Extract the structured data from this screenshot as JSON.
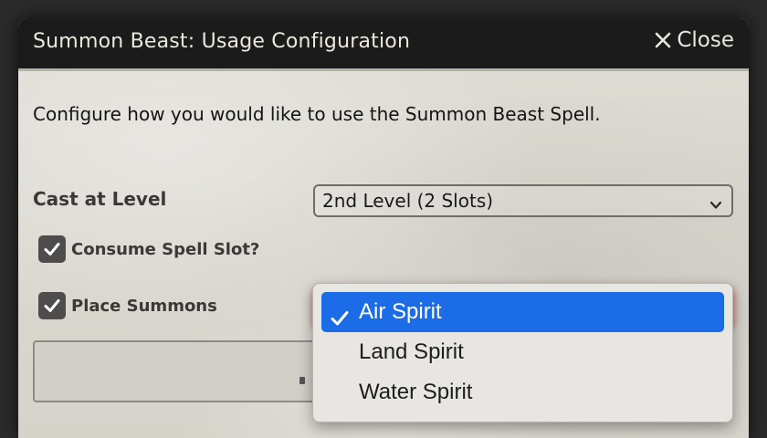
{
  "dialog": {
    "title": "Summon Beast: Usage Configuration",
    "close_label": "Close",
    "intro": "Configure how you would like to use the Summon Beast Spell."
  },
  "cast_level": {
    "label": "Cast at Level",
    "selected": "2nd Level (2 Slots)"
  },
  "consume_slot": {
    "label": "Consume Spell Slot?",
    "checked": true
  },
  "place_summons": {
    "label": "Place Summons",
    "checked": true
  },
  "spirit_dropdown": {
    "options": [
      "Air Spirit",
      "Land Spirit",
      "Water Spirit"
    ],
    "selected": "Air Spirit"
  },
  "colors": {
    "accent": "#1b6ce6",
    "titlebar": "#1b1b1b",
    "checkbox": "#4f4d4b"
  }
}
